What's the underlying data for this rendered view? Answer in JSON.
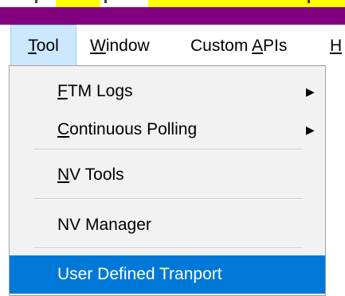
{
  "menubar": {
    "items": [
      {
        "label": "Tool",
        "mnemonic": "T",
        "rest": "ool"
      },
      {
        "label": "Window",
        "mnemonic": "W",
        "rest": "indow"
      },
      {
        "label": "Custom APIs",
        "pre": "Custom ",
        "mnemonic": "A",
        "rest": "PIs"
      },
      {
        "label": "H",
        "mnemonic": "H",
        "rest": ""
      }
    ]
  },
  "dropdown": {
    "items": [
      {
        "pre": "",
        "mnemonic": "F",
        "rest": "TM Logs",
        "submenu_arrow": "▶"
      },
      {
        "pre": "",
        "mnemonic": "C",
        "rest": "ontinuous Polling",
        "submenu_arrow": "▶"
      },
      {
        "pre": "",
        "mnemonic": "N",
        "rest": "V Tools"
      },
      {
        "pre": "NV Mana",
        "mnemonic": "g",
        "rest": "er"
      },
      {
        "label": "User Defined Tranport"
      }
    ]
  },
  "colors": {
    "title_bar": "#800080",
    "highlight": "#ffff00",
    "selection": "#0078d7",
    "menu_hover": "#cce8ff"
  }
}
